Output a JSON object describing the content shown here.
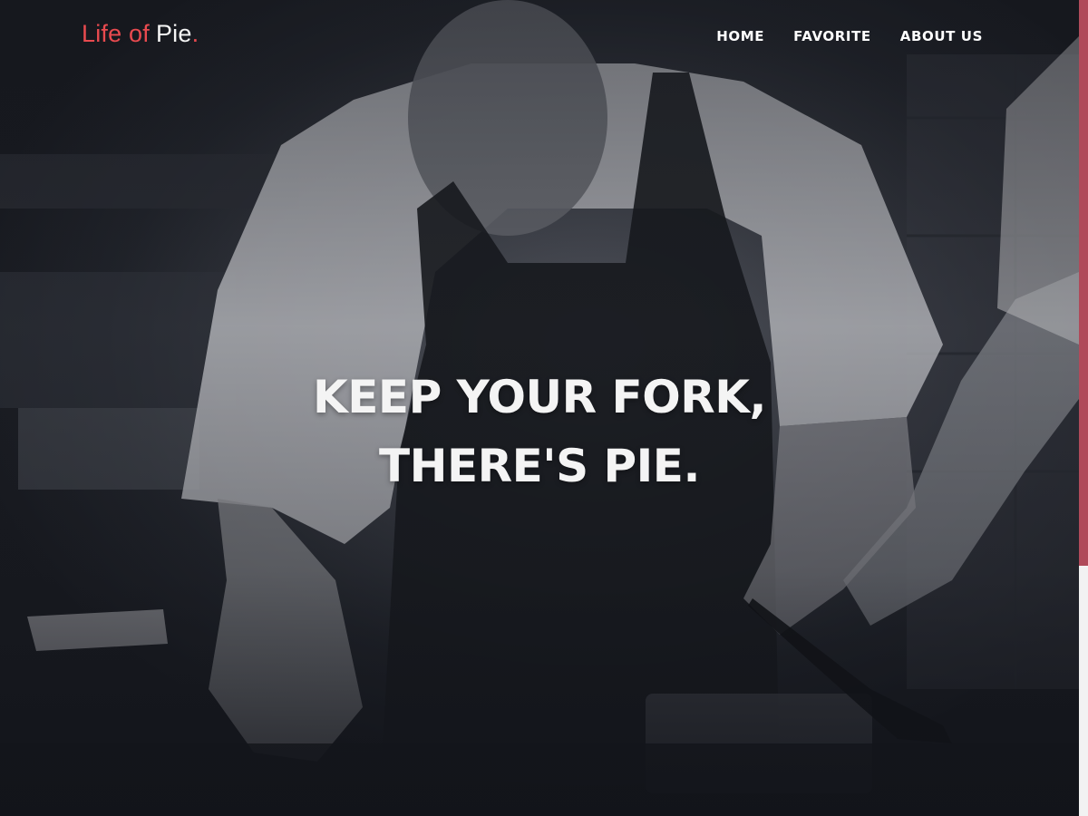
{
  "logo": {
    "part1": "Life of",
    "part2": "Pie",
    "dot": ".",
    "accent_color": "#e84a4f"
  },
  "nav": {
    "items": [
      {
        "label": "HOME"
      },
      {
        "label": "FAVORITE"
      },
      {
        "label": "ABOUT US"
      }
    ]
  },
  "hero": {
    "headline_line1": "KEEP YOUR FORK,",
    "headline_line2": "THERE'S PIE."
  },
  "scrollbar": {
    "thumb_color": "#b04a5a"
  }
}
